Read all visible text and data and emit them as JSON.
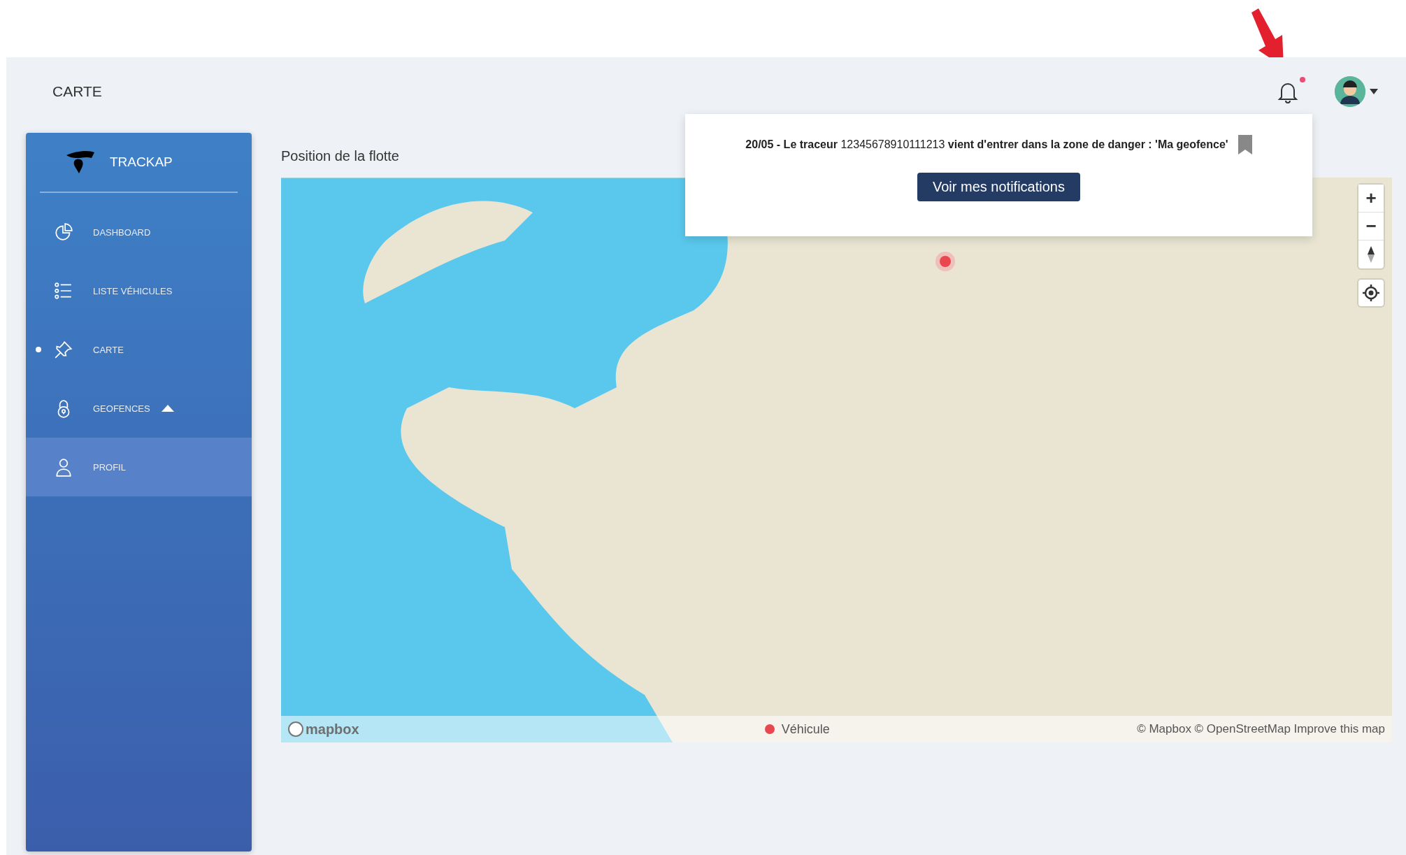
{
  "header": {
    "title": "CARTE",
    "notifications_unread": true
  },
  "sidebar": {
    "brand": "TRACKAP",
    "items": [
      {
        "label": "DASHBOARD",
        "kind": "chart",
        "selected": false,
        "hovered": false,
        "expanded": false
      },
      {
        "label": "LISTE VÉHICULES",
        "kind": "list",
        "selected": false,
        "hovered": false,
        "expanded": false
      },
      {
        "label": "CARTE",
        "kind": "pin",
        "selected": true,
        "hovered": false,
        "expanded": false
      },
      {
        "label": "GEOFENCES",
        "kind": "lock",
        "selected": false,
        "hovered": false,
        "expanded": true
      },
      {
        "label": "PROFIL",
        "kind": "user",
        "selected": false,
        "hovered": true,
        "expanded": false
      }
    ]
  },
  "main": {
    "title": "Position de la flotte",
    "map": {
      "zoom_controls": [
        "+",
        "−"
      ],
      "logo": "mapbox",
      "legend": [
        {
          "label": "Véhicule",
          "color": "#e8474f"
        }
      ],
      "attribution": "© Mapbox © OpenStreetMap Improve this map"
    }
  },
  "notification_popup": {
    "message": "**20/05 - Le traceur** 12345678910111213 **vient d'entrer dans la zone de danger : 'Ma geofence'**",
    "button": "Voir mes notifications"
  }
}
